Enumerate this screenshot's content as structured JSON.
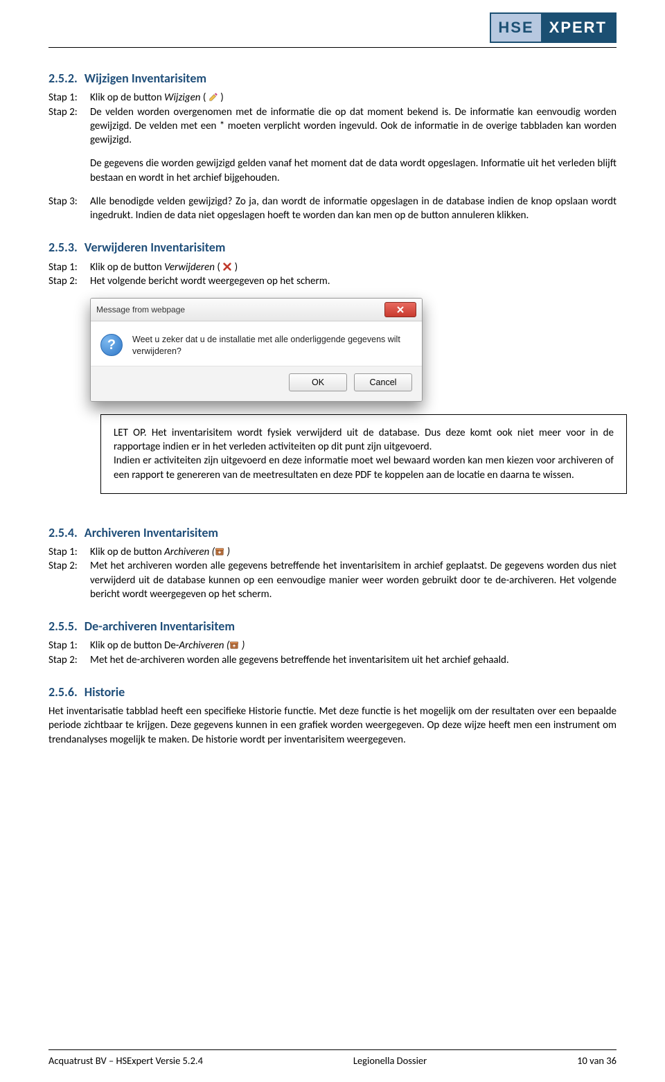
{
  "logo": {
    "left": "HSE",
    "right": "XPERT"
  },
  "s252": {
    "num": "2.5.2.",
    "title": "Wijzigen Inventarisitem",
    "step1_label": "Stap 1:",
    "step1_text_a": "Klik op de button ",
    "step1_text_italic": "Wijzigen",
    "step1_text_b": " ( ",
    "step1_text_c": " )",
    "step2_label": "Stap 2:",
    "step2_text": "De velden worden overgenomen met de informatie die op dat moment bekend is. De informatie kan eenvoudig worden gewijzigd. De velden met een * moeten verplicht worden ingevuld. Ook de informatie in de overige tabbladen kan worden gewijzigd.",
    "step2_para2": "De gegevens die worden gewijzigd gelden vanaf het moment dat de data wordt opgeslagen. Informatie uit het verleden blijft bestaan en wordt in het archief bijgehouden.",
    "step3_label": "Stap 3:",
    "step3_text": "Alle benodigde velden gewijzigd? Zo ja, dan wordt de informatie opgeslagen in de database indien de knop opslaan wordt ingedrukt. Indien de data niet opgeslagen hoeft te worden dan kan men op de button annuleren klikken."
  },
  "s253": {
    "num": "2.5.3.",
    "title": "Verwijderen Inventarisitem",
    "step1_label": "Stap 1:",
    "step1_a": "Klik op de button ",
    "step1_i": "Verwijderen",
    "step1_b": " ( ",
    "step1_c": "  )",
    "step2_label": "Stap 2:",
    "step2_text": "Het volgende bericht wordt weergegeven op het scherm."
  },
  "dialog": {
    "title": "Message from webpage",
    "body": "Weet u zeker dat u de installatie met alle onderliggende gegevens wilt verwijderen?",
    "ok": "OK",
    "cancel": "Cancel"
  },
  "note": {
    "text": "LET OP. Het inventarisitem wordt fysiek verwijderd uit de database. Dus deze komt ook niet meer voor in de rapportage indien er in het verleden activiteiten op dit punt zijn uitgevoerd.\nIndien er activiteiten zijn uitgevoerd en deze informatie moet wel bewaard worden kan men kiezen voor archiveren of een rapport te genereren van de meetresultaten en deze PDF te koppelen aan de locatie en daarna te wissen."
  },
  "s254": {
    "num": "2.5.4.",
    "title": "Archiveren Inventarisitem",
    "step1_label": "Stap 1:",
    "step1_a": "Klik op de button ",
    "step1_i": "Archiveren (",
    "step1_c": " )",
    "step2_label": "Stap 2:",
    "step2_text": "Met het archiveren worden alle gegevens betreffende het inventarisitem in archief geplaatst. De gegevens worden dus niet verwijderd uit de database kunnen op een eenvoudige manier weer worden gebruikt door te de-archiveren. Het volgende bericht wordt weergegeven op het scherm."
  },
  "s255": {
    "num": "2.5.5.",
    "title": "De-archiveren Inventarisitem",
    "step1_label": "Stap 1:",
    "step1_a": "Klik op de button De-",
    "step1_i": "Archiveren (",
    "step1_c": " )",
    "step2_label": "Stap 2:",
    "step2_text": "Met het de-archiveren worden alle gegevens betreffende het inventarisitem uit het archief gehaald."
  },
  "s256": {
    "num": "2.5.6.",
    "title": "Historie",
    "body": "Het inventarisatie tabblad heeft een specifieke Historie functie. Met deze functie is het mogelijk om der resultaten over een bepaalde periode zichtbaar te krijgen. Deze gegevens kunnen in een grafiek worden weergegeven. Op deze wijze heeft men een instrument om trendanalyses mogelijk te maken. De historie wordt per inventarisitem weergegeven."
  },
  "footer": {
    "left": "Acquatrust BV – HSExpert Versie 5.2.4",
    "center": "Legionella Dossier",
    "right": "10 van 36"
  }
}
